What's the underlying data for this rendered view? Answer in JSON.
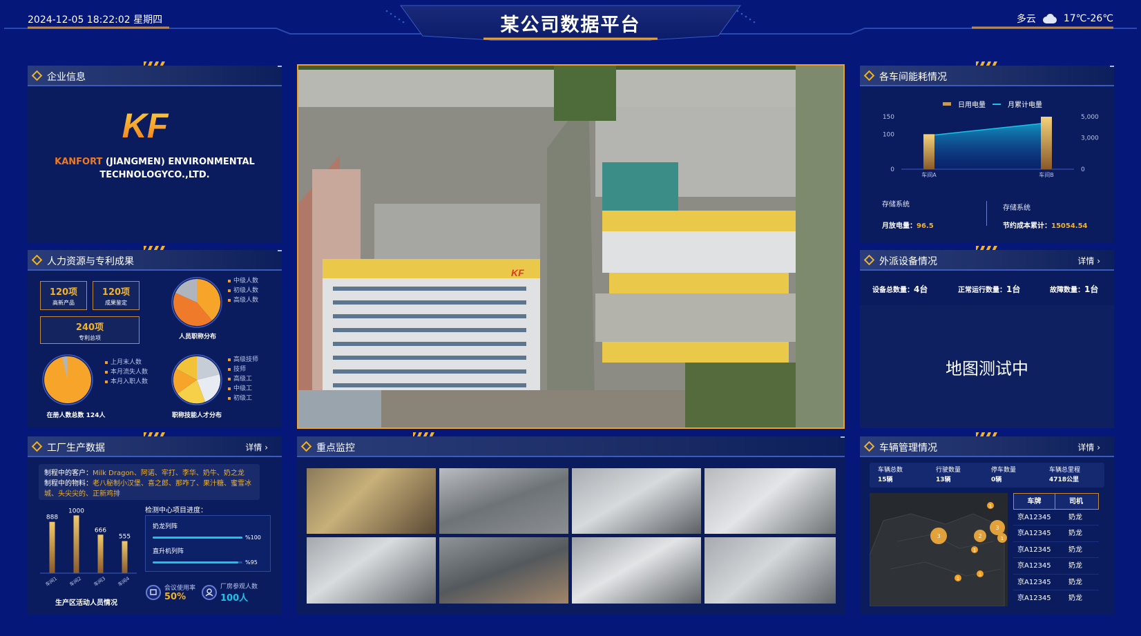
{
  "header": {
    "datetime": "2024-12-05 18:22:02 星期四",
    "title": "某公司数据平台",
    "weather": "多云",
    "temperature": "17℃-26℃",
    "weather_icon": "cloud-icon"
  },
  "panels": {
    "enterprise": {
      "title": "企业信息",
      "logo_text": "KF",
      "company_highlight": "KANFORT",
      "company_line1": " (JIANGMEN) ENVIRONMENTAL",
      "company_line2": "TECHNOLOGYCO.,LTD."
    },
    "hr": {
      "title": "人力资源与专利成果",
      "stats": [
        {
          "value": "120项",
          "label": "高新产品"
        },
        {
          "value": "120项",
          "label": "成果鉴定"
        },
        {
          "value": "240项",
          "label": "专利总项"
        }
      ],
      "pie1": {
        "label": "人员职称分布",
        "legend": [
          "中级人数",
          "初级人数",
          "高级人数"
        ],
        "values": [
          45,
          35,
          20
        ]
      },
      "pie2": {
        "label": "在册人数总数 124人",
        "legend": [
          "上月末人数",
          "本月流失人数",
          "本月入职人数"
        ],
        "values": [
          96,
          3,
          1
        ]
      },
      "pie3": {
        "label": "职称技能人才分布",
        "legend": [
          "高级技师",
          "技师",
          "高级工",
          "中级工",
          "初级工"
        ],
        "values": [
          30,
          25,
          20,
          15,
          10
        ]
      }
    },
    "factory": {
      "title": "工厂生产数据",
      "more": "详情 ›",
      "customers_label": "制程中的客户：",
      "customers": "Milk Dragon、阿诺、牢打、李华、奶牛、奶之龙",
      "materials_label": "制程中的物料：",
      "materials": "老八秘制小汉堡、喜之郎、那咋了、果汁糖、蜜雪冰城、头尖尖的、正新鸡排",
      "chart_title": "生产区活动人员情况",
      "progress_title": "检测中心项目进度：",
      "progress": [
        {
          "name": "奶龙列阵",
          "pct": 100,
          "label": "%100"
        },
        {
          "name": "直升机列阵",
          "pct": 95,
          "label": "%95"
        }
      ],
      "meeting_label": "会议使用率",
      "meeting_value": "50%",
      "visitor_label": "厂房参观人数",
      "visitor_value": "100人"
    },
    "monitor": {
      "title": "重点监控"
    },
    "energy": {
      "title": "各车间能耗情况",
      "legend_bar": "日用电量",
      "legend_line": "月累计电量",
      "sys1_label": "存储系统",
      "sys1_key": "月放电量：",
      "sys1_val": "96.5",
      "sys2_label": "存储系统",
      "sys2_key": "节约成本累计：",
      "sys2_val": "15054.54"
    },
    "devices": {
      "title": "外派设备情况",
      "more": "详情 ›",
      "total_key": "设备总数量：",
      "total_val": "4台",
      "running_key": "正常运行数量：",
      "running_val": "1台",
      "fault_key": "故障数量：",
      "fault_val": "1台",
      "map_text": "地图测试中"
    },
    "vehicles": {
      "title": "车辆管理情况",
      "more": "详情 ›",
      "stats": [
        {
          "label": "车辆总数",
          "value": "15辆"
        },
        {
          "label": "行驶数量",
          "value": "13辆"
        },
        {
          "label": "停车数量",
          "value": "0辆"
        },
        {
          "label": "车辆总里程",
          "value": "4718公里"
        }
      ],
      "table_headers": [
        "车牌",
        "司机"
      ],
      "rows": [
        [
          "京A12345",
          "奶龙"
        ],
        [
          "京A12345",
          "奶龙"
        ],
        [
          "京A12345",
          "奶龙"
        ],
        [
          "京A12345",
          "奶龙"
        ],
        [
          "京A12345",
          "奶龙"
        ],
        [
          "京A12345",
          "奶龙"
        ]
      ],
      "map_clusters": [
        {
          "n": "1"
        },
        {
          "n": "3"
        },
        {
          "n": "3"
        },
        {
          "n": "2"
        },
        {
          "n": "1"
        },
        {
          "n": "1"
        },
        {
          "n": "1"
        },
        {
          "n": "1"
        }
      ]
    }
  },
  "chart_data": [
    {
      "type": "bar",
      "title": "生产区活动人员情况",
      "categories": [
        "车间1",
        "车间2",
        "车间3",
        "车间4"
      ],
      "values": [
        888,
        1000,
        666,
        555
      ],
      "ylim": [
        0,
        1100
      ]
    },
    {
      "type": "bar+line",
      "categories": [
        "车间A",
        "车间B"
      ],
      "series": [
        {
          "name": "日用电量",
          "type": "bar",
          "values": [
            100,
            150
          ]
        },
        {
          "name": "月累计电量",
          "type": "line",
          "values": [
            3200,
            4400
          ]
        }
      ],
      "y_left": {
        "ticks": [
          0,
          100,
          150
        ],
        "ylim": [
          0,
          150
        ]
      },
      "y_right": {
        "ticks": [
          0,
          3000,
          5000
        ],
        "ylim": [
          0,
          5000
        ]
      }
    }
  ],
  "colors": {
    "background": "#06177a",
    "panel": "#0a1c5e",
    "accent_gold": "#f2b226",
    "accent_orange": "#f07a1f",
    "accent_cyan": "#18c4e8"
  }
}
